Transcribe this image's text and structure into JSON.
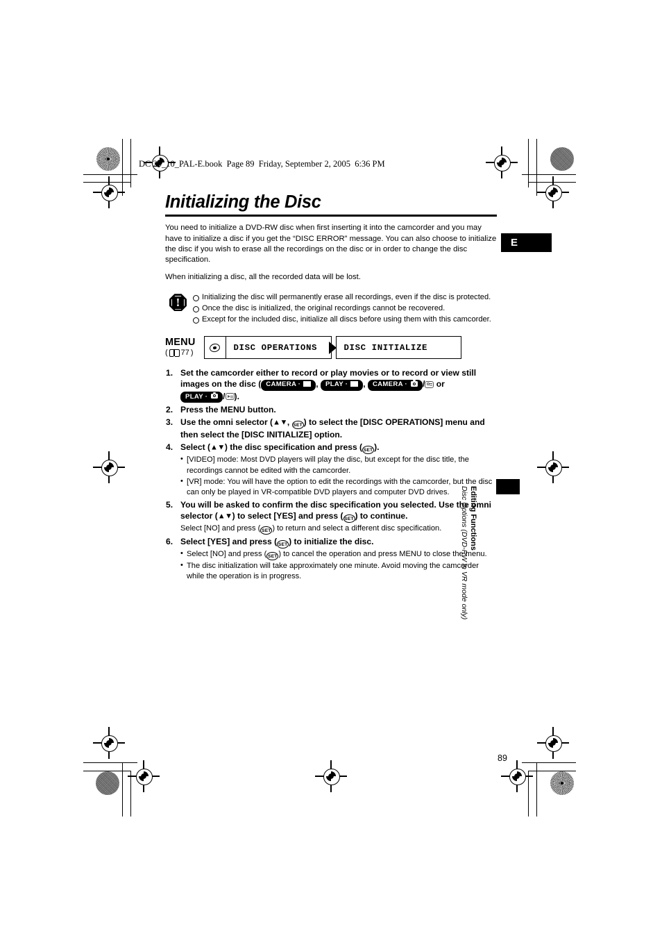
{
  "print": {
    "slug": "DC 20_10_PAL-E.book  Page 89  Friday, September 2, 2005  6:36 PM",
    "page_number": "89"
  },
  "header": {
    "title": "Initializing the Disc",
    "language_tab": "E"
  },
  "intro": {
    "paragraph_1": "You need to initialize a DVD-RW disc when first inserting it into the camcorder and you may have to initialize a disc if you get the “DISC ERROR” message. You can also choose to initialize the disc if you wish to erase all the recordings on the disc or in order to change the disc specification.",
    "paragraph_2": "When initializing a disc, all the recorded data will be lost."
  },
  "caution": {
    "icon": "warning-octagon-icon",
    "items": [
      "Initializing the disc will permanently erase all recordings, even if the disc is protected.",
      "Once the disc is initialized, the original recordings cannot be recovered.",
      "Except for the included disc, initialize all discs before using them with this camcorder."
    ]
  },
  "menu_path": {
    "label": "MENU",
    "ref_page": "77",
    "book_icon": "book-icon",
    "disc_icon": "disc-icon",
    "arrow_icon": "right-arrow-icon",
    "box_1": "DISC OPERATIONS",
    "box_2": "DISC INITIALIZE"
  },
  "steps": [
    {
      "number": "1.",
      "text_a": "Set the camcorder either to record or play movies or to record or view still images on the disc (",
      "badge_1": "CAMERA",
      "badge_2": "PLAY",
      "badge_3": "CAMERA",
      "badge_4": "PLAY",
      "sep_1": ",",
      "sep_2": ",",
      "sep_3": "/",
      "sep_4": "or",
      "sep_5": "/",
      "text_end": ")."
    },
    {
      "number": "2.",
      "text": "Press the MENU button."
    },
    {
      "number": "3.",
      "text_a": "Use the omni selector (",
      "arrows": "▲▼",
      "comma": ",",
      "set": "SET",
      "text_b": ") to select the [DISC OPERATIONS] menu and then select the [DISC INITIALIZE] option."
    },
    {
      "number": "4.",
      "text_a": "Select (",
      "arrows": "▲▼",
      "text_b": ") the disc specification and press (",
      "set": "SET",
      "text_c": ").",
      "bullets": [
        "[VIDEO] mode: Most DVD players will play the disc, but except for the disc title, the recordings cannot be edited with the camcorder.",
        "[VR] mode: You will have the option to edit the recordings with the camcorder, but the disc can only be played in VR-compatible DVD players and computer DVD drives."
      ]
    },
    {
      "number": "5.",
      "text_a": "You will be asked to confirm the disc specification you selected. Use the omni selector (",
      "arrows": "▲▼",
      "text_b": ") to select [YES] and press (",
      "set": "SET",
      "text_c": ") to continue.",
      "sub_a": "Select [NO] and press (",
      "sub_set": "SET",
      "sub_b": ") to return and select a different disc specification."
    },
    {
      "number": "6.",
      "text_a": "Select [YES] and press (",
      "set": "SET",
      "text_b": ") to initialize the disc.",
      "bullets": [
        "Select [NO] and press (SET) to cancel the operation and press MENU to close the menu.",
        "The disc initialization will take approximately one minute. Avoid moving the camcorder while the operation is in progress."
      ],
      "bullet_1_a": "Select [NO] and press (",
      "bullet_1_set": "SET",
      "bullet_1_b": ") to cancel the operation and press MENU to close the menu.",
      "bullet_2": "The disc initialization will take approximately one minute. Avoid moving the camcorder while the operation is in progress."
    }
  ],
  "running_head": {
    "line_1": "Editing Functions",
    "line_2": "Disc Options (DVD-RW in VR mode only)"
  },
  "colors": {
    "ink": "#000000",
    "paper": "#ffffff"
  }
}
